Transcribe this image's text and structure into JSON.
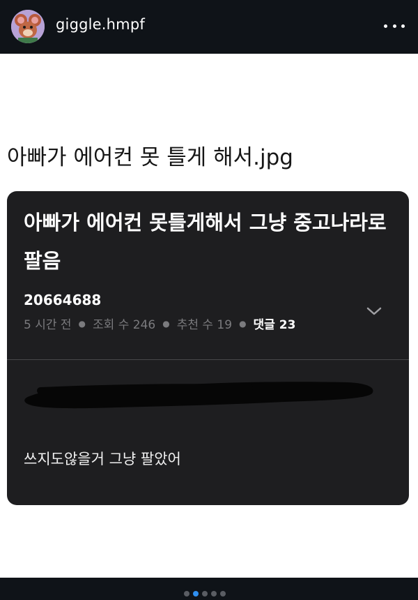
{
  "header": {
    "username": "giggle.hmpf",
    "avatar_icon": "cartoon-mouse-avatar",
    "more_icon": "more-horizontal-icon"
  },
  "post": {
    "caption": "아빠가 에어컨 못 틀게 해서.jpg"
  },
  "screenshot_card": {
    "title": "아빠가 에어컨 못틀게해서 그냥 중고나라로 팔음",
    "post_id": "20664688",
    "time": "5 시간 전",
    "views": "조회 수 246",
    "recommends": "추천 수 19",
    "comments": "댓글 23",
    "expand_icon": "chevron-down-icon",
    "body": "쓰지도않을거 그냥 팔았어"
  },
  "carousel": {
    "total": 5,
    "active_index": 1
  },
  "colors": {
    "bar_bg": "#0f1318",
    "card_bg": "#1e1e20",
    "active_dot": "#2f8ff0"
  }
}
